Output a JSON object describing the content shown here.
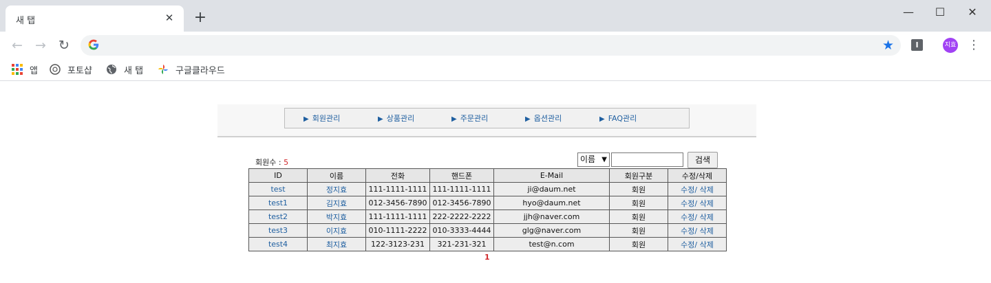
{
  "browser": {
    "tab_title": "새 탭",
    "tab_close": "✕",
    "new_tab": "+",
    "window_controls": {
      "minimize": "—",
      "maximize": "☐",
      "close": "✕"
    },
    "nav": {
      "back": "←",
      "forward": "→",
      "reload": "↻"
    },
    "omnibox_value": "",
    "extension_letter": "I",
    "avatar_text": "지효",
    "menu_glyph": "⋮",
    "bookmarks": [
      {
        "label": "앱",
        "icon": "apps-icon"
      },
      {
        "label": "포토샵",
        "icon": "photoshop-icon"
      },
      {
        "label": "새 탭",
        "icon": "globe-icon"
      },
      {
        "label": "구글클라우드",
        "icon": "google-photos-icon"
      }
    ]
  },
  "admin_menu": [
    {
      "label": "회원관리"
    },
    {
      "label": "상품관리"
    },
    {
      "label": "주문관리"
    },
    {
      "label": "옵션관리"
    },
    {
      "label": "FAQ관리"
    }
  ],
  "member_count": {
    "label": "회원수 : ",
    "value": "5"
  },
  "search": {
    "select_value": "이름",
    "input_value": "",
    "button_label": "검색"
  },
  "table": {
    "headers": [
      "ID",
      "이름",
      "전화",
      "핸드폰",
      "E-Mail",
      "회원구분",
      "수정/삭제"
    ],
    "rows": [
      {
        "id": "test",
        "name": "정지효",
        "phone": "111-1111-1111",
        "mobile": "111-1111-1111",
        "email": "ji@daum.net",
        "type": "회원",
        "actions": "수정/ 삭제"
      },
      {
        "id": "test1",
        "name": "김지효",
        "phone": "012-3456-7890",
        "mobile": "012-3456-7890",
        "email": "hyo@daum.net",
        "type": "회원",
        "actions": "수정/ 삭제"
      },
      {
        "id": "test2",
        "name": "박지효",
        "phone": "111-1111-1111",
        "mobile": "222-2222-2222",
        "email": "jjh@naver.com",
        "type": "회원",
        "actions": "수정/ 삭제"
      },
      {
        "id": "test3",
        "name": "이지효",
        "phone": "010-1111-2222",
        "mobile": "010-3333-4444",
        "email": "glg@naver.com",
        "type": "회원",
        "actions": "수정/ 삭제"
      },
      {
        "id": "test4",
        "name": "최지효",
        "phone": "122-3123-231",
        "mobile": "321-231-321",
        "email": "test@n.com",
        "type": "회원",
        "actions": "수정/ 삭제"
      }
    ]
  },
  "pagination": {
    "current": "1"
  },
  "colors": {
    "link": "#1f5fa0",
    "accent_red": "#d0282b",
    "star": "#1a73e8",
    "avatar": "#a142f4"
  }
}
